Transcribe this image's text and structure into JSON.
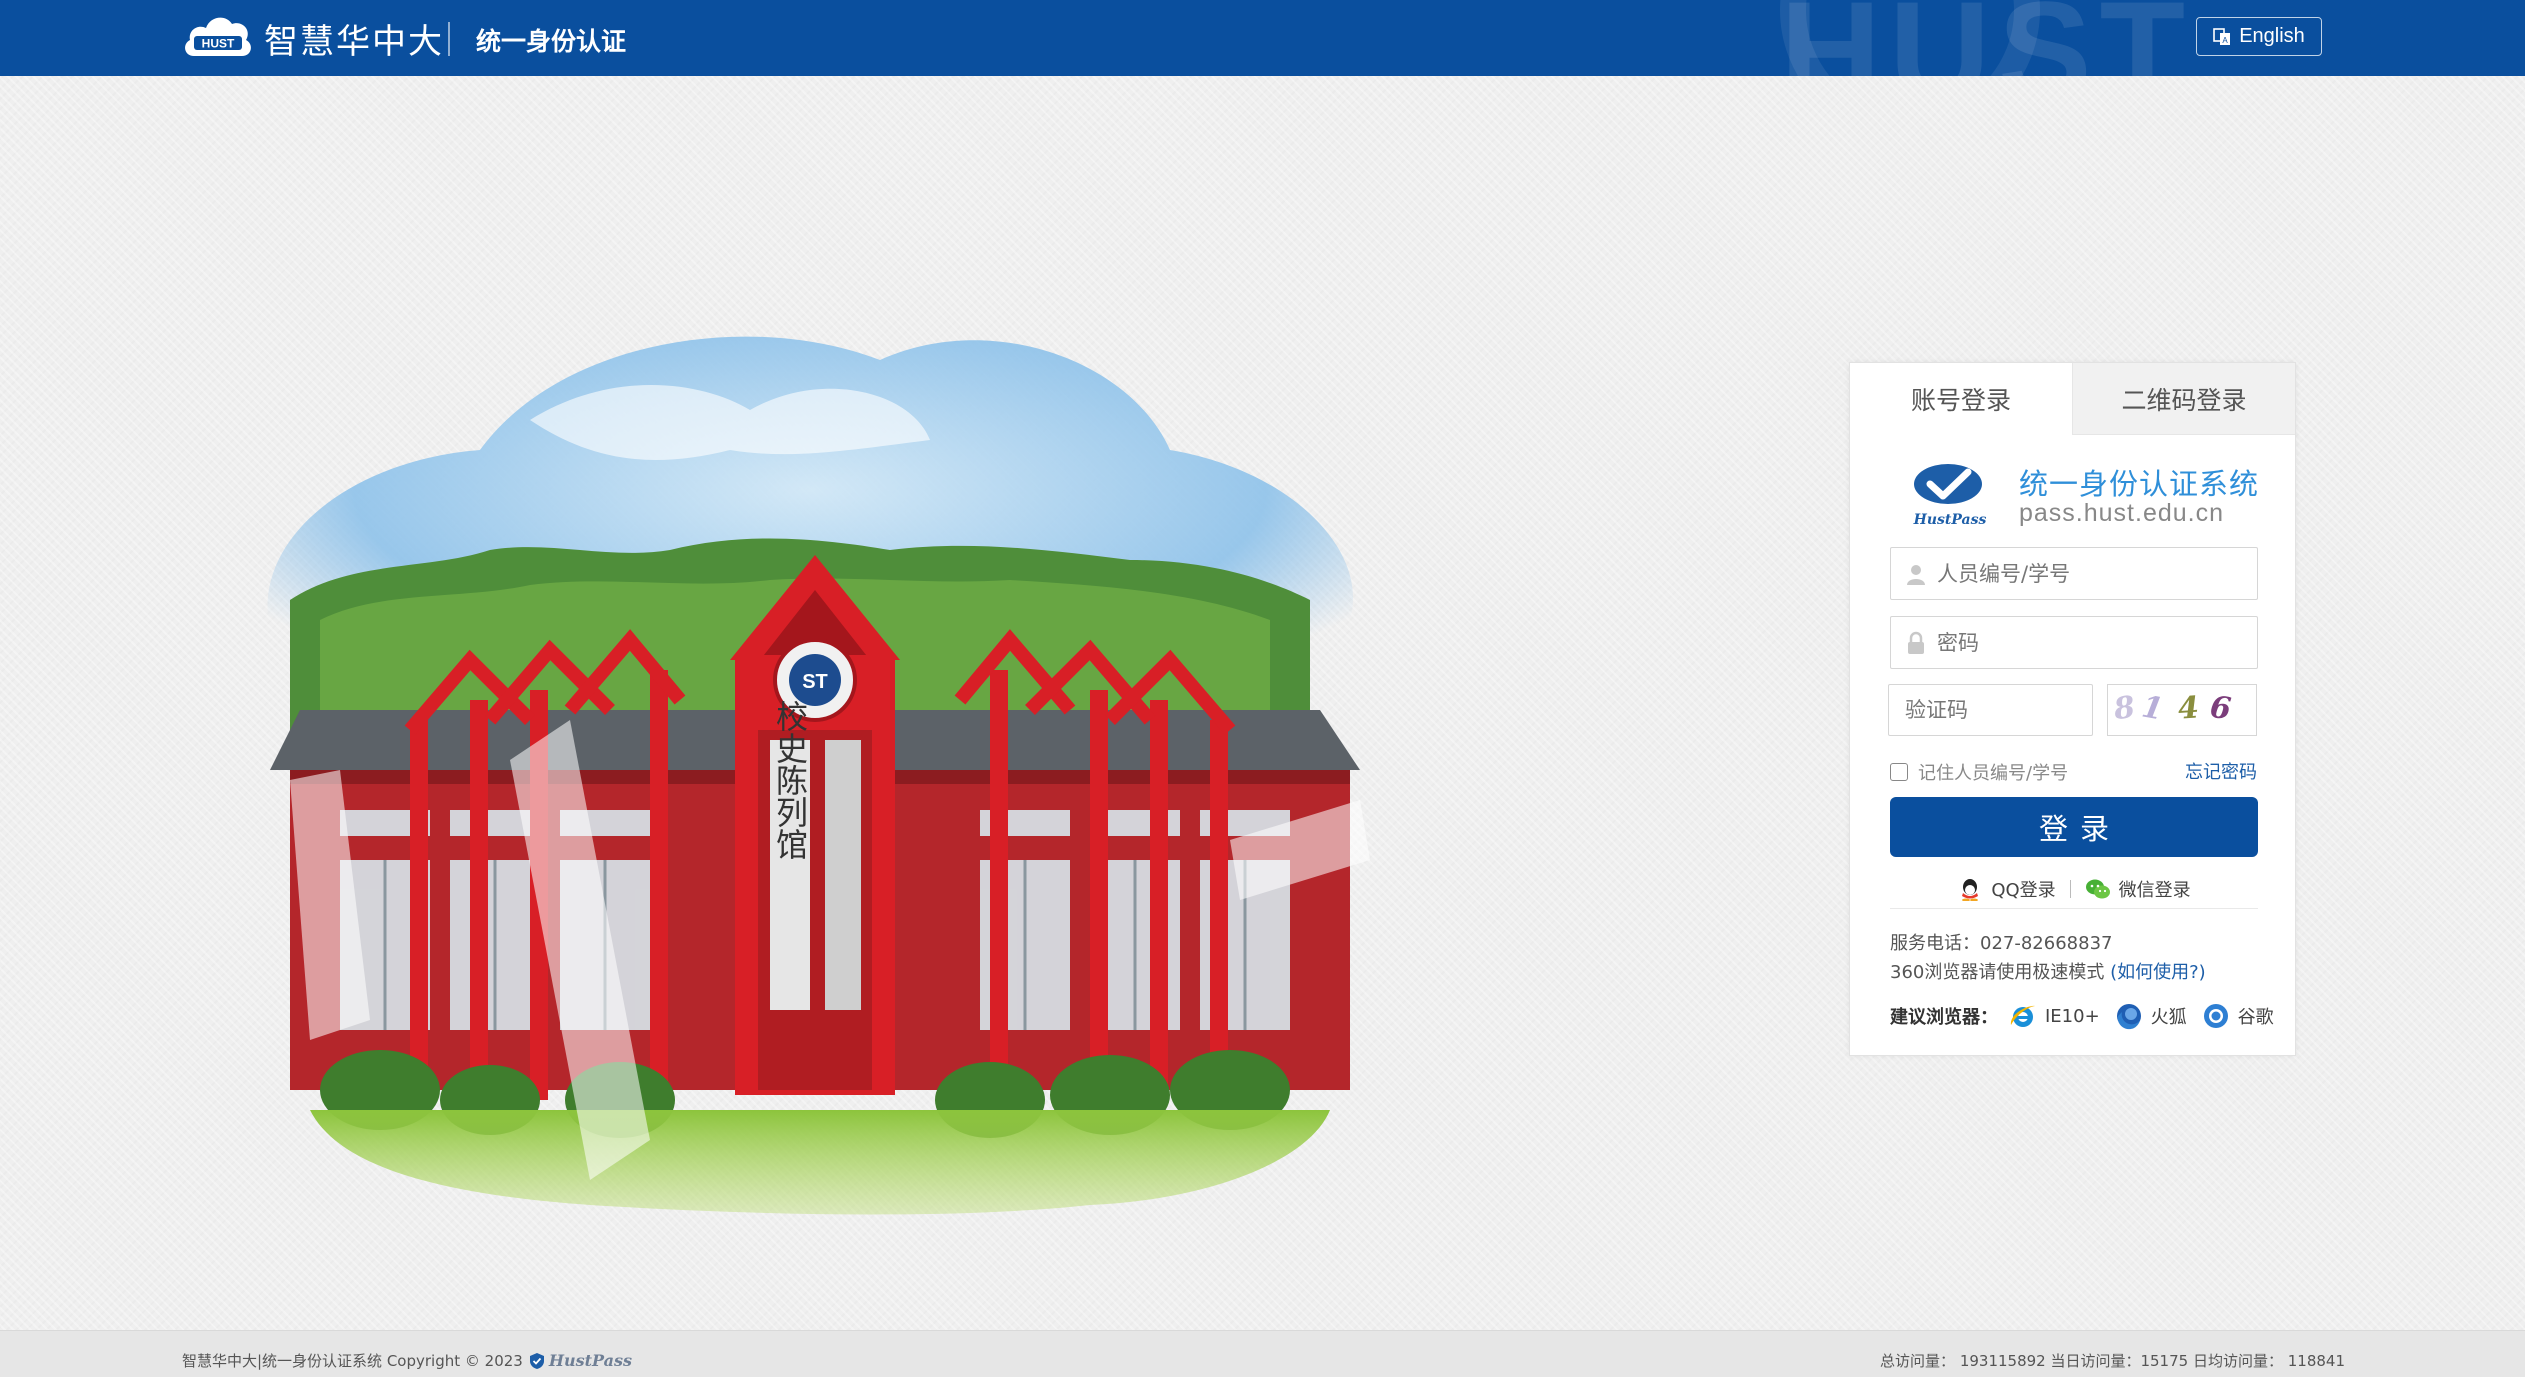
{
  "header": {
    "logo_mark": "HUST",
    "brand": "智慧华中大",
    "subtitle": "统一身份认证",
    "watermark": "HUST",
    "lang_button": "English",
    "colors": {
      "bar": "#0a4f9e"
    }
  },
  "hero": {
    "signboard": "校史陈列馆"
  },
  "login": {
    "tabs": [
      {
        "label": "账号登录",
        "active": true
      },
      {
        "label": "二维码登录",
        "active": false
      }
    ],
    "system_logo_text": "HustPass",
    "system_title": "统一身份认证系统",
    "system_url": "pass.hust.edu.cn",
    "username_placeholder": "人员编号/学号",
    "password_placeholder": "密码",
    "captcha_placeholder": "验证码",
    "captcha_chars": [
      "8",
      "1",
      "4",
      "6"
    ],
    "remember_label": "记住人员编号/学号",
    "forgot_link": "忘记密码",
    "login_button": "登录",
    "social": [
      {
        "label": "QQ登录",
        "icon": "qq-icon"
      },
      {
        "label": "微信登录",
        "icon": "wechat-icon"
      }
    ],
    "service_phone": "服务电话：027-82668837",
    "browser_note": "360浏览器请使用极速模式",
    "browser_note_link": "(如何使用?)",
    "recommend_label": "建议浏览器：",
    "browsers": [
      {
        "label": "IE10+",
        "icon": "ie-icon"
      },
      {
        "label": "火狐",
        "icon": "firefox-icon"
      },
      {
        "label": "谷歌",
        "icon": "chrome-icon"
      }
    ],
    "colors": {
      "primary": "#0a4f9e",
      "link": "#1d5ea8",
      "title": "#2f8fd9"
    }
  },
  "footer": {
    "copyright": "智慧华中大|统一身份认证系统 Copyright © 2023",
    "logo_text": "HustPass",
    "stats": "总访问量： 193115892 当日访问量：15175 日均访问量： 118841"
  }
}
